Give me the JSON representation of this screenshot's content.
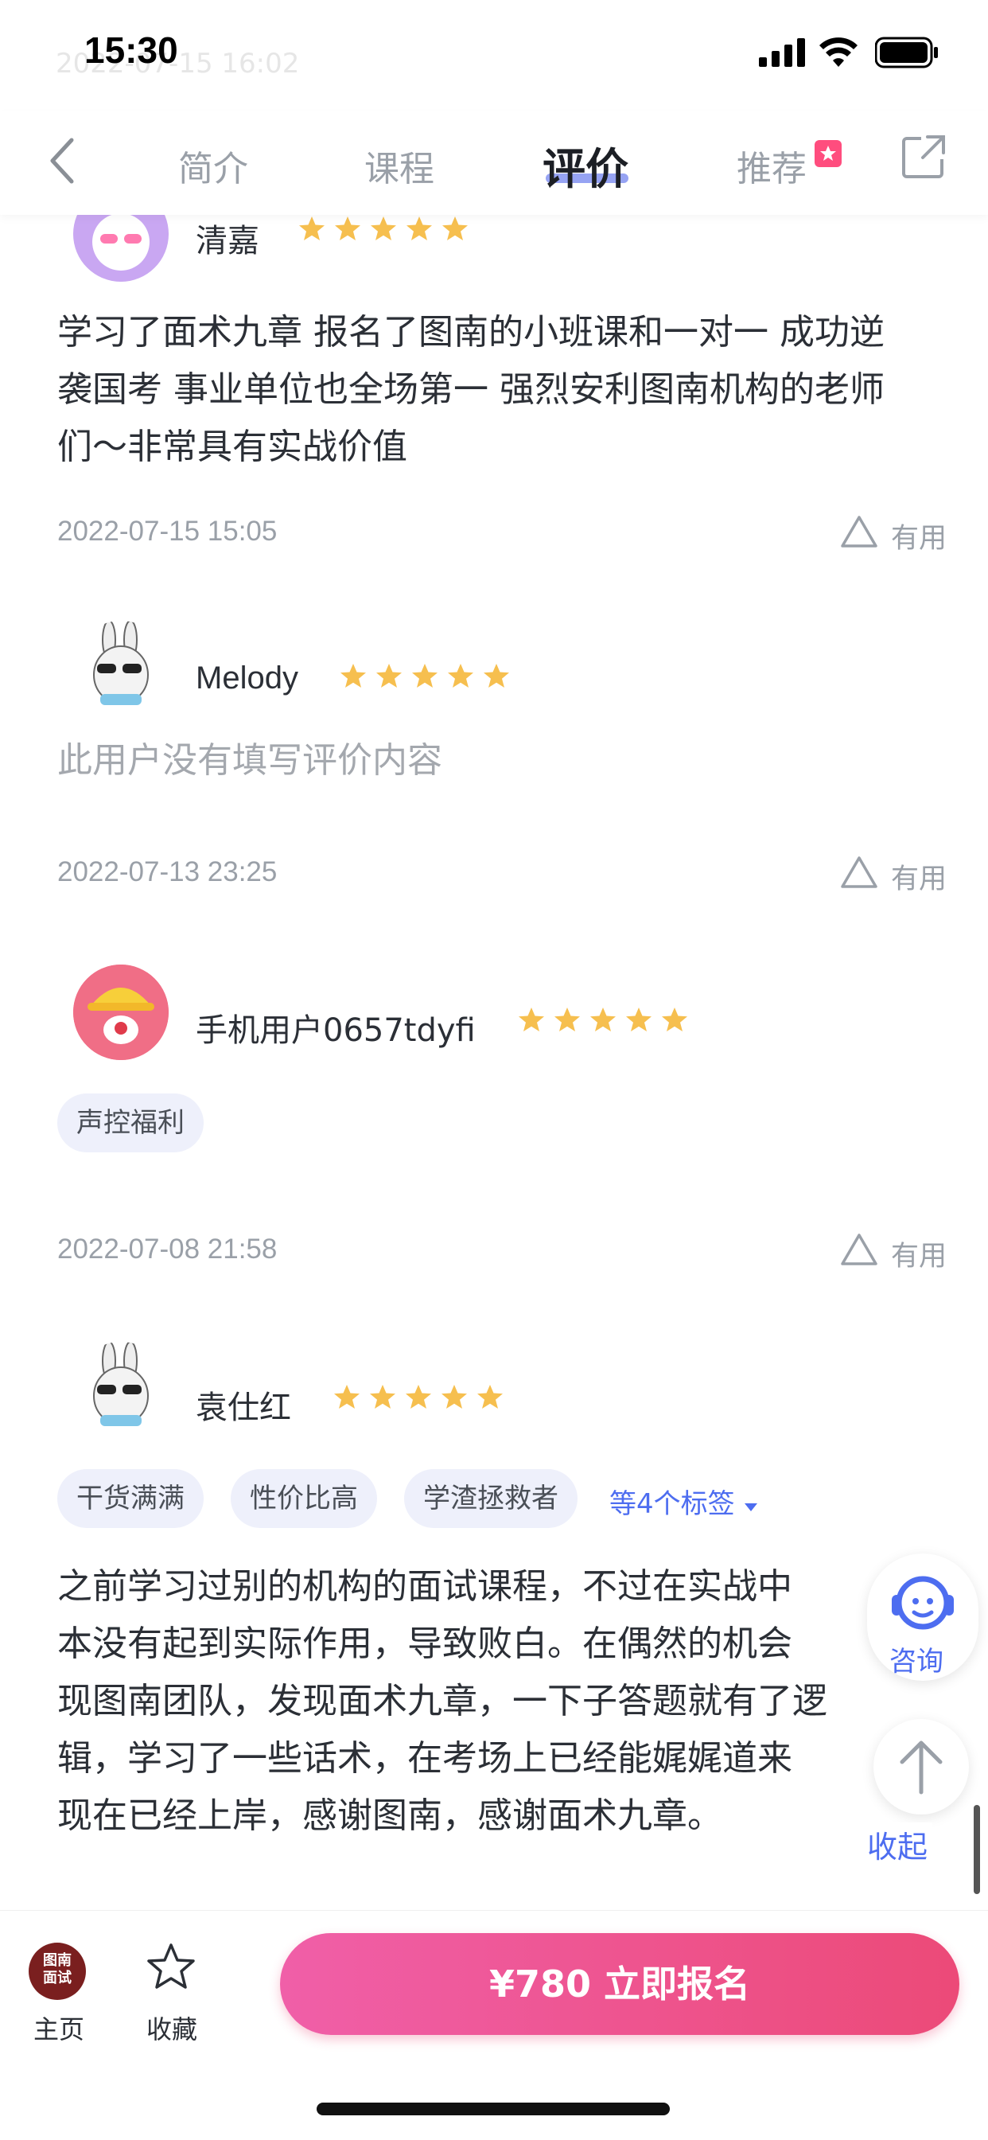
{
  "status_bar": {
    "time": "15:30",
    "ghost_text": "2022-07-15 16:02"
  },
  "nav": {
    "tabs": [
      {
        "label": "简介"
      },
      {
        "label": "课程"
      },
      {
        "label": "评价"
      },
      {
        "label": "推荐"
      }
    ],
    "active_tab": "评价"
  },
  "reviews": [
    {
      "user": "清嘉",
      "rating": 5,
      "text": "学习了面术九章 报名了图南的小班课和一对一 成功逆袭国考 事业单位也全场第一 强烈安利图南机构的老师们～非常具有实战价值",
      "date": "2022-07-15 15:05",
      "useful": "有用"
    },
    {
      "user": "Melody",
      "rating": 5,
      "text": "此用户没有填写评价内容",
      "date": "2022-07-13 23:25",
      "useful": "有用"
    },
    {
      "user": "手机用户0657tdyfi",
      "rating": 5,
      "tags": [
        "声控福利"
      ],
      "date": "2022-07-08 21:58",
      "useful": "有用"
    },
    {
      "user": "袁仕红",
      "rating": 5,
      "tags": [
        "干货满满",
        "性价比高",
        "学渣拯救者"
      ],
      "more_tags": "等4个标签",
      "text_lines": [
        "之前学习过别的机构的面试课程，不过在实战中",
        "本没有起到实际作用，导致败白。在偶然的机会",
        "现图南团队，发现面术九章，一下子答题就有了逻",
        "辑，学习了一些话术，在考场上已经能娓娓道来",
        "现在已经上岸，感谢图南，感谢面术九章。"
      ]
    }
  ],
  "floating": {
    "consult": "咨询",
    "collapse": "收起"
  },
  "bottom_bar": {
    "logo_text": "图南\n面试",
    "home_label": "主页",
    "favorite_label": "收藏",
    "cta_label": "¥780  立即报名"
  },
  "colors": {
    "accent": "#4d6df0",
    "cta_start": "#f05fa8",
    "cta_end": "#ec4a78",
    "star": "#f6bf4f"
  },
  "icons": [
    "back-chevron-icon",
    "share-icon",
    "warning-triangle-icon",
    "star-icon",
    "customer-service-icon",
    "arrow-up-icon",
    "favorite-star-icon"
  ]
}
